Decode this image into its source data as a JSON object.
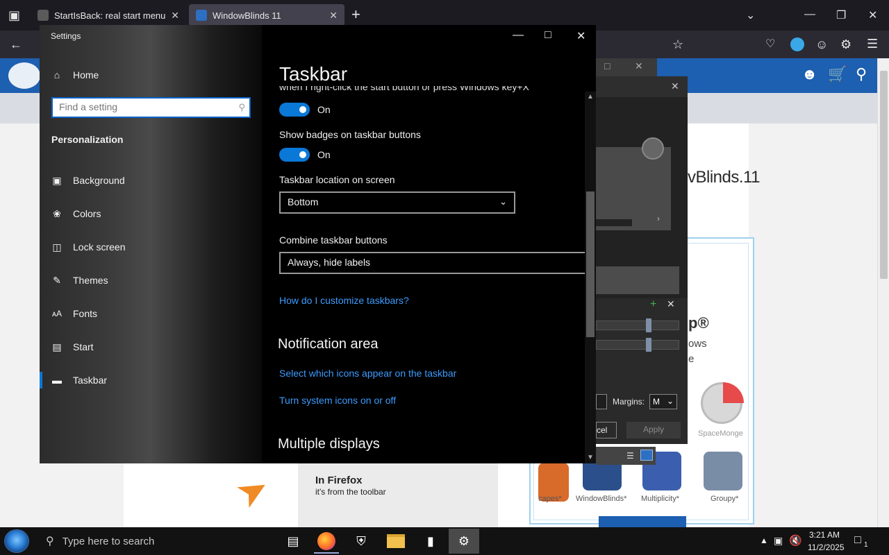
{
  "browser": {
    "tabs": [
      {
        "title": "StartIsBack: real start menu for W"
      },
      {
        "title": "WindowBlinds 11"
      }
    ],
    "new_tab_glyph": "+"
  },
  "website": {
    "heading_fragment": "vBlinds.11",
    "headline_fragment": "p®",
    "line2_fragment": "ows",
    "line3_fragment": "e",
    "firefox_title": "In Firefox",
    "firefox_sub": "it's from the toolbar",
    "product_labels": [
      "capes*",
      "WindowBlinds*",
      "Multiplicity*",
      "Groupy*"
    ],
    "spacemonger_label": "SpaceMonge"
  },
  "bg_dialog": {
    "margins_label": "Margins:",
    "margins_value": "M",
    "cancel_label": "cel",
    "apply_label": "Apply"
  },
  "settings": {
    "window_title": "Settings",
    "home_label": "Home",
    "search_placeholder": "Find a setting",
    "section_header": "Personalization",
    "nav_items": [
      {
        "label": "Background",
        "icon": "picture-icon"
      },
      {
        "label": "Colors",
        "icon": "palette-icon"
      },
      {
        "label": "Lock screen",
        "icon": "lock-screen-icon"
      },
      {
        "label": "Themes",
        "icon": "brush-icon"
      },
      {
        "label": "Fonts",
        "icon": "font-icon"
      },
      {
        "label": "Start",
        "icon": "start-icon"
      },
      {
        "label": "Taskbar",
        "icon": "taskbar-icon"
      }
    ],
    "selected_nav": "Taskbar",
    "page_title": "Taskbar",
    "cut_off_text": "when I right-click the start button or press Windows key+X",
    "toggle1_state": "On",
    "badges_label": "Show badges on taskbar buttons",
    "toggle2_state": "On",
    "location_label": "Taskbar location on screen",
    "location_value": "Bottom",
    "combine_label": "Combine taskbar buttons",
    "combine_value": "Always, hide labels",
    "customize_link": "How do I customize taskbars?",
    "notification_heading": "Notification area",
    "select_icons_link": "Select which icons appear on the taskbar",
    "system_icons_link": "Turn system icons on or off",
    "multiple_displays_heading": "Multiple displays",
    "accent_color": "#0a78d7",
    "link_color": "#3c9cff"
  },
  "taskbar": {
    "search_placeholder": "Type here to search",
    "time": "3:21 AM",
    "date": "11/2/2025",
    "notification_count": "1"
  }
}
